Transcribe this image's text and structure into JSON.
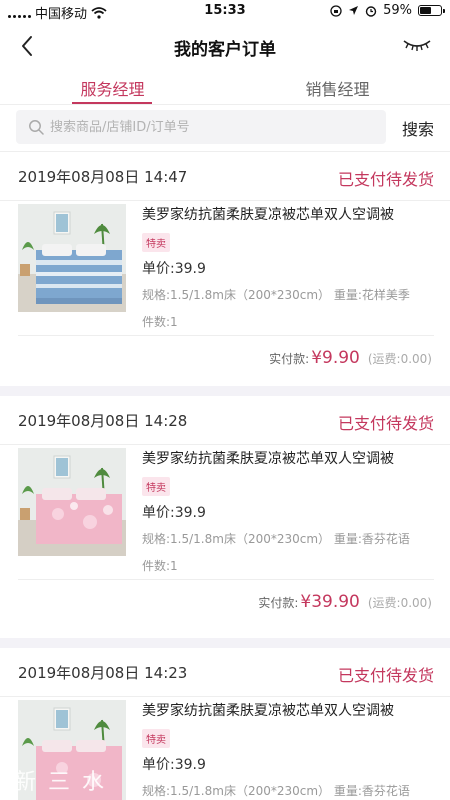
{
  "status_bar": {
    "carrier": "中国移动",
    "time": "15:33",
    "battery": "59%",
    "battery_level": 0.59
  },
  "nav": {
    "title": "我的客户订单"
  },
  "tabs": [
    {
      "label": "服务经理",
      "active": true
    },
    {
      "label": "销售经理",
      "active": false
    }
  ],
  "search": {
    "placeholder": "搜索商品/店铺ID/订单号",
    "button": "搜索"
  },
  "orders": [
    {
      "date": "2019年08月08日 14:47",
      "status": "已支付待发货",
      "product_name": "美罗家纺抗菌柔肤夏凉被芯单双人空调被",
      "tag": "特卖",
      "unit_price": "单价:39.9",
      "spec": "规格:1.5/1.8m床（200*230cm） 重量:花样美季",
      "count": "件数:1",
      "paid_label": "实付款:",
      "paid_amount": "¥9.90",
      "freight": "(运费:0.00)",
      "palette": "blue"
    },
    {
      "date": "2019年08月08日 14:28",
      "status": "已支付待发货",
      "product_name": "美罗家纺抗菌柔肤夏凉被芯单双人空调被",
      "tag": "特卖",
      "unit_price": "单价:39.9",
      "spec": "规格:1.5/1.8m床（200*230cm） 重量:香芬花语",
      "count": "件数:1",
      "paid_label": "实付款:",
      "paid_amount": "¥39.90",
      "freight": "(运费:0.00)",
      "palette": "pink"
    },
    {
      "date": "2019年08月08日 14:23",
      "status": "已支付待发货",
      "product_name": "美罗家纺抗菌柔肤夏凉被芯单双人空调被",
      "tag": "特卖",
      "unit_price": "单价:39.9",
      "spec": "规格:1.5/1.8m床（200*230cm） 重量:香芬花语",
      "count": "",
      "paid_label": "",
      "paid_amount": "",
      "freight": "",
      "palette": "pink"
    }
  ],
  "watermark": "新三水",
  "colors": {
    "accent": "#c4385e",
    "tag_bg": "#fbe5ec",
    "search_bg": "#f3f3f5",
    "section_gap": "#f3f2f7"
  }
}
